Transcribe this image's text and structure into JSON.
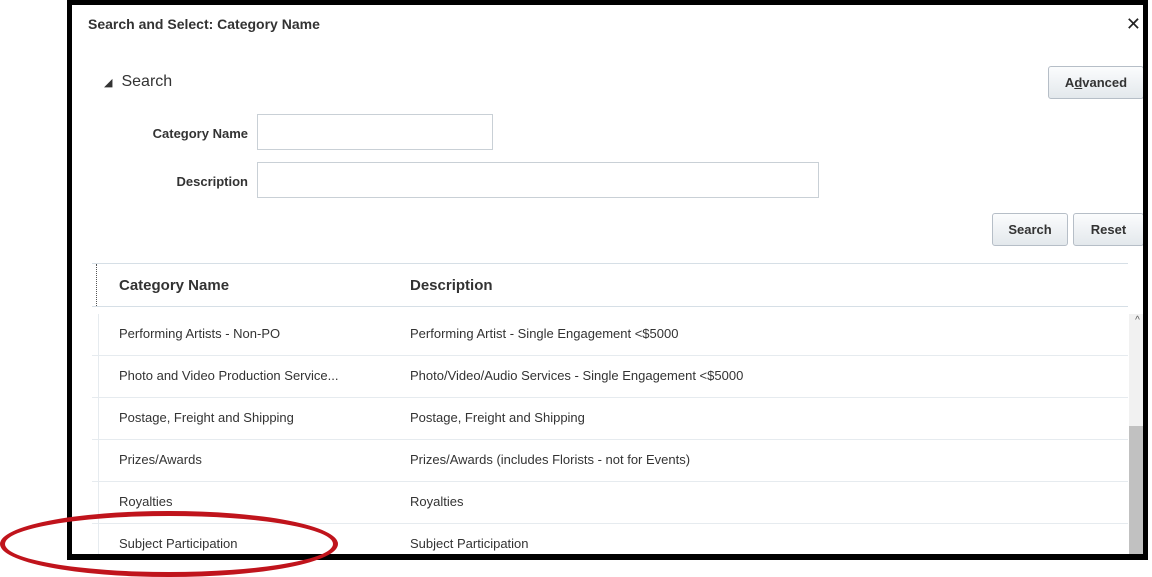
{
  "dialog": {
    "title": "Search and Select: Category Name",
    "close_glyph": "✕"
  },
  "search_panel": {
    "header": "Search",
    "advanced_button": "Advanced",
    "fields": {
      "category_name_label": "Category Name",
      "category_name_value": "",
      "description_label": "Description",
      "description_value": ""
    },
    "search_button": "Search",
    "reset_button": "Reset"
  },
  "table": {
    "columns": [
      "Category Name",
      "Description"
    ],
    "rows": [
      {
        "category": "Performing Artists - Non-PO",
        "description": "Performing Artist - Single Engagement <$5000"
      },
      {
        "category": "Photo and Video Production Service...",
        "description": "Photo/Video/Audio Services - Single Engagement <$5000"
      },
      {
        "category": "Postage, Freight and Shipping",
        "description": "Postage, Freight and Shipping"
      },
      {
        "category": "Prizes/Awards",
        "description": "Prizes/Awards (includes Florists - not for Events)"
      },
      {
        "category": "Royalties",
        "description": "Royalties"
      },
      {
        "category": "Subject Participation",
        "description": "Subject Participation"
      }
    ]
  },
  "annotation_color": "#c0141c"
}
